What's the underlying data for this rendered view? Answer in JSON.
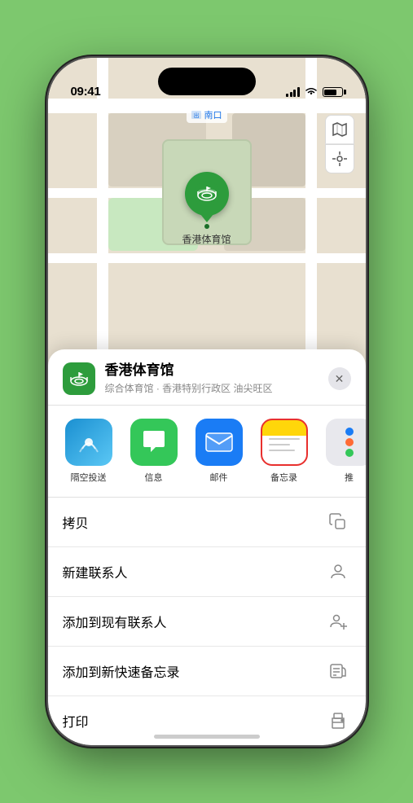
{
  "phone": {
    "time": "09:41",
    "map_label": "南口"
  },
  "venue": {
    "name": "香港体育馆",
    "subtitle": "综合体育馆 · 香港特别行政区 油尖旺区",
    "logo_emoji": "🏟"
  },
  "share_apps": [
    {
      "id": "airdrop",
      "label": "隔空投送",
      "type": "airdrop"
    },
    {
      "id": "messages",
      "label": "信息",
      "type": "messages"
    },
    {
      "id": "mail",
      "label": "邮件",
      "type": "mail"
    },
    {
      "id": "notes",
      "label": "备忘录",
      "type": "notes"
    }
  ],
  "actions": [
    {
      "label": "拷贝",
      "icon": "copy"
    },
    {
      "label": "新建联系人",
      "icon": "new-contact"
    },
    {
      "label": "添加到现有联系人",
      "icon": "add-contact"
    },
    {
      "label": "添加到新快速备忘录",
      "icon": "quick-note"
    },
    {
      "label": "打印",
      "icon": "print"
    }
  ]
}
